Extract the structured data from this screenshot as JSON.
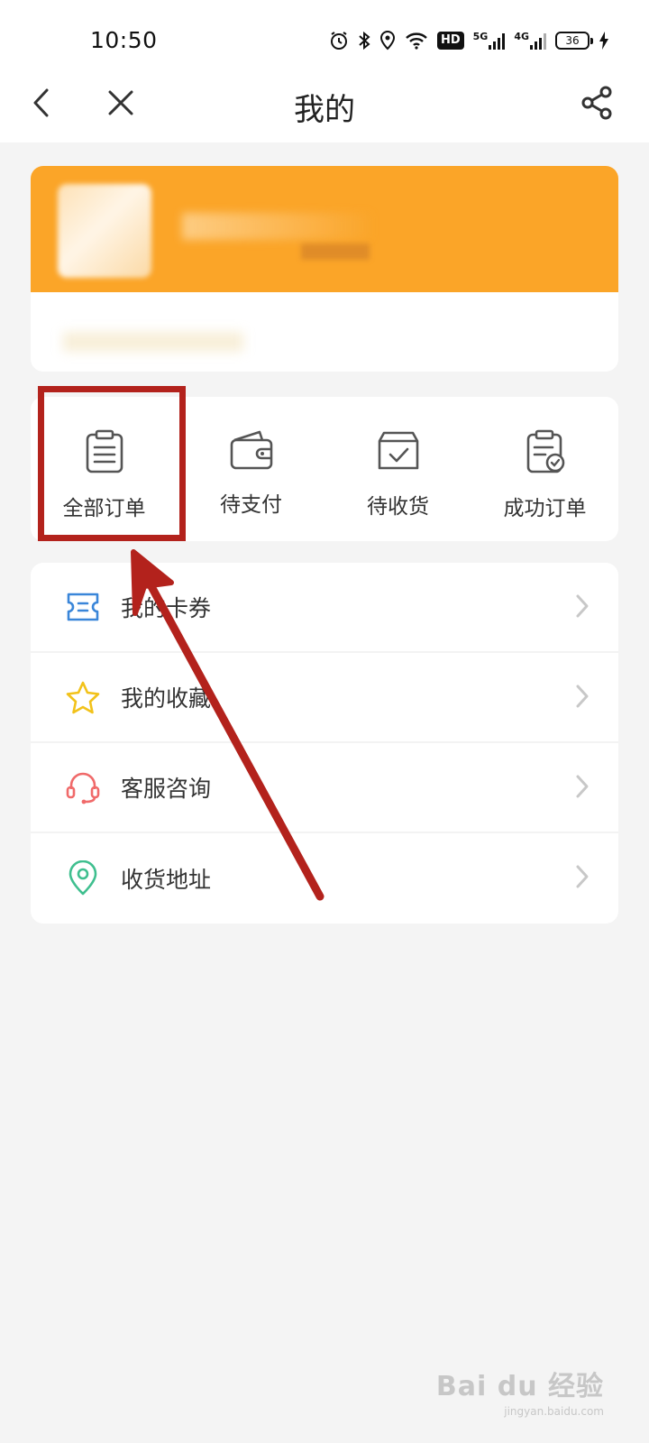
{
  "status_bar": {
    "time": "10:50",
    "hd_badge": "HD",
    "network_1": "5G",
    "network_2": "4G",
    "battery": "36"
  },
  "nav": {
    "title": "我的"
  },
  "orders": {
    "items": [
      {
        "label": "全部订单",
        "icon": "clipboard-icon"
      },
      {
        "label": "待支付",
        "icon": "wallet-icon"
      },
      {
        "label": "待收货",
        "icon": "box-check-icon"
      },
      {
        "label": "成功订单",
        "icon": "clipboard-check-icon"
      }
    ]
  },
  "menu": {
    "items": [
      {
        "label": "我的卡券",
        "icon": "coupon-icon",
        "color": "#3a86d9"
      },
      {
        "label": "我的收藏",
        "icon": "star-icon",
        "color": "#f2c21a"
      },
      {
        "label": "客服咨询",
        "icon": "headset-icon",
        "color": "#f06a6a"
      },
      {
        "label": "收货地址",
        "icon": "location-pin-icon",
        "color": "#3fbf8f"
      }
    ]
  },
  "colors": {
    "accent": "#fba528",
    "annotation": "#b3221c"
  },
  "watermark": {
    "main": "Bai du 经验",
    "sub": "jingyan.baidu.com"
  }
}
